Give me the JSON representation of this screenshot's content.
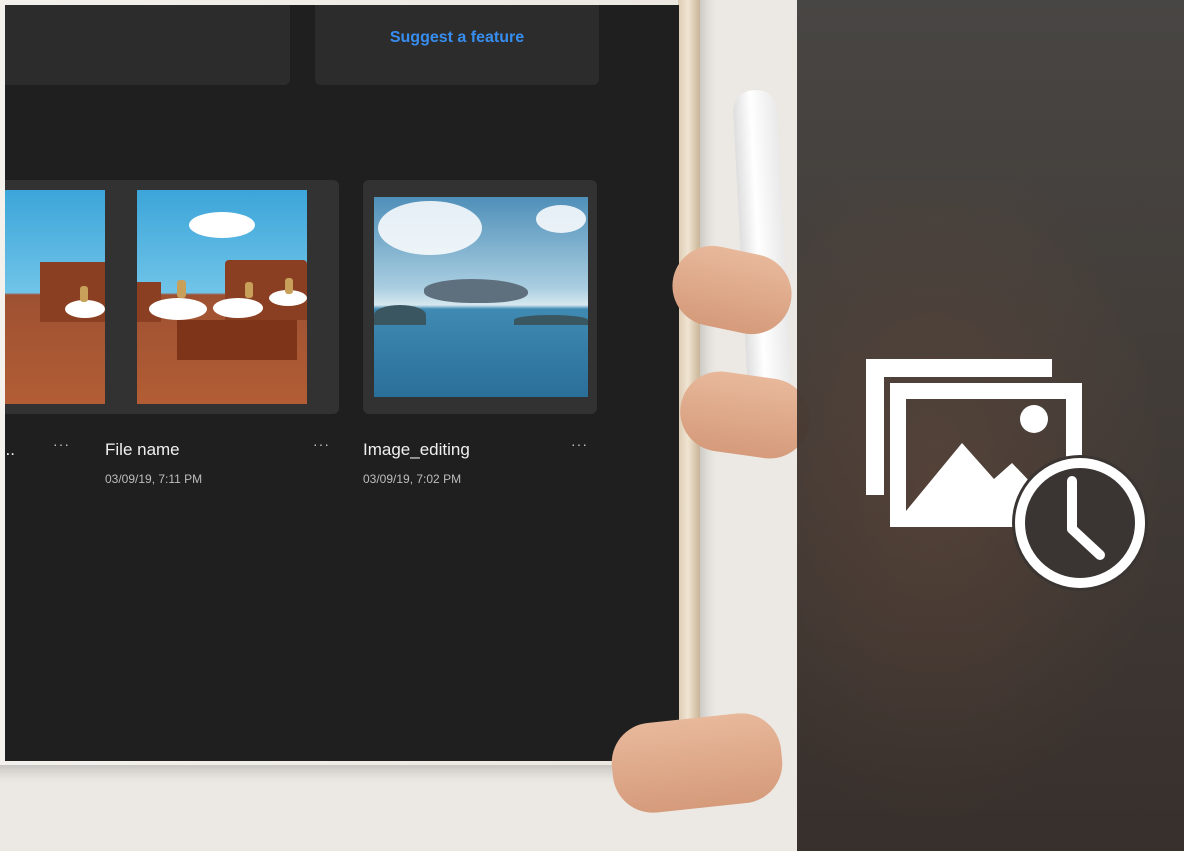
{
  "top_cards": {
    "suggest_label": "Suggest a feature"
  },
  "files": [
    {
      "name": "l...",
      "date": "",
      "more_label": "···"
    },
    {
      "name": "File name",
      "date": "03/09/19, 7:11 PM",
      "more_label": "···"
    },
    {
      "name": "Image_editing",
      "date": "03/09/19, 7:02 PM",
      "more_label": "···"
    }
  ],
  "overlay": {
    "icon": "recent-images-clock-icon"
  },
  "colors": {
    "screen_bg": "#1f1f1f",
    "card_bg": "#323232",
    "link": "#378ef0",
    "overlay": "#3f3b38"
  }
}
